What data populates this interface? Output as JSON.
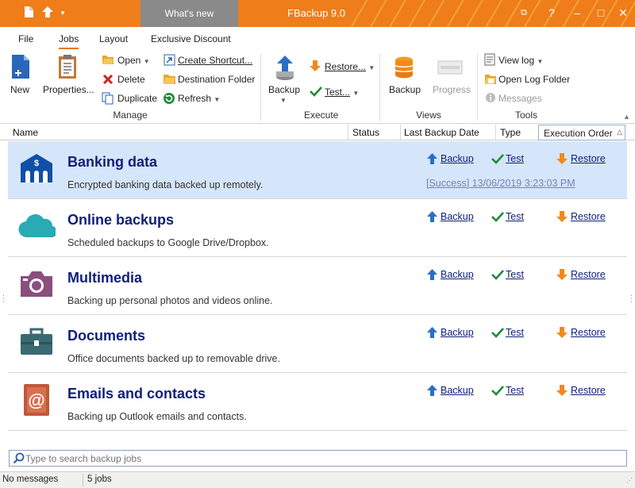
{
  "titlebar": {
    "whats_new": "What's new",
    "app_title": "FBackup 9.0",
    "colors": {
      "bar": "#ef7d1a",
      "whats_new_bg": "#8a8a8a"
    }
  },
  "ribbon_tabs": [
    "File",
    "Jobs",
    "Layout",
    "Exclusive Discount"
  ],
  "ribbon": {
    "new_label": "New",
    "properties_label": "Properties...",
    "open_label": "Open",
    "delete_label": "Delete",
    "duplicate_label": "Duplicate",
    "create_shortcut_label": "Create Shortcut...",
    "destination_folder_label": "Destination Folder",
    "refresh_label": "Refresh",
    "manage_group": "Manage",
    "backup_label": "Backup",
    "restore_label": "Restore...",
    "test_label": "Test...",
    "execute_group": "Execute",
    "views_backup_label": "Backup",
    "progress_label": "Progress",
    "views_group": "Views",
    "view_log_label": "View log",
    "open_log_folder_label": "Open Log Folder",
    "messages_label": "Messages",
    "tools_group": "Tools"
  },
  "columns": {
    "name": "Name",
    "status": "Status",
    "last_backup_date": "Last Backup Date",
    "type": "Type",
    "execution_order": "Execution Order"
  },
  "jobs": [
    {
      "title": "Banking data",
      "description": "Encrypted banking data backed up remotely.",
      "icon": "bank-icon",
      "status": "[Success] 13/06/2019 3:23:03 PM",
      "selected": true
    },
    {
      "title": "Online backups",
      "description": "Scheduled backups to Google Drive/Dropbox.",
      "icon": "cloud-icon"
    },
    {
      "title": "Multimedia",
      "description": "Backing up personal photos and videos online.",
      "icon": "camera-icon"
    },
    {
      "title": "Documents",
      "description": "Office documents backed up to removable drive.",
      "icon": "briefcase-icon"
    },
    {
      "title": "Emails and contacts",
      "description": "Backing up Outlook emails and contacts.",
      "icon": "email-book-icon"
    }
  ],
  "job_actions": {
    "backup": "Backup",
    "test": "Test",
    "restore": "Restore"
  },
  "search": {
    "placeholder": "Type to search backup jobs"
  },
  "statusbar": {
    "messages": "No messages",
    "jobs_count": "5 jobs"
  },
  "colors": {
    "accent": "#e37800",
    "job_title": "#10207a",
    "selected_row": "#d6e6fa"
  }
}
